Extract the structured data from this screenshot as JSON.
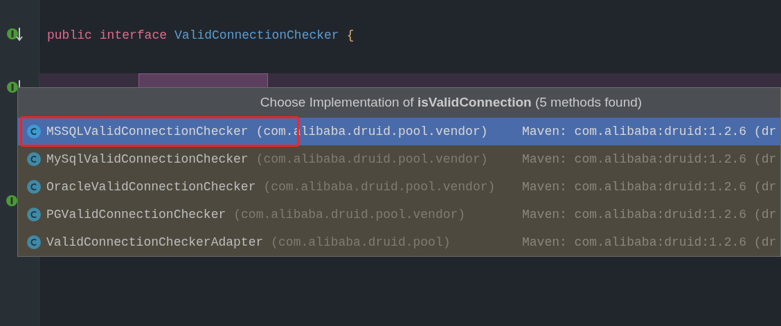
{
  "code_line": [
    {
      "kind": "keyword",
      "text": "public"
    },
    {
      "kind": "keyword",
      "text": "interface"
    },
    {
      "kind": "type",
      "text": "ValidConnectionChecker"
    },
    {
      "kind": "brace",
      "text": "{"
    }
  ],
  "popup": {
    "title_prefix": "Choose Implementation of ",
    "method": "isValidConnection",
    "title_suffix": " (5 methods found)",
    "rows": [
      {
        "name": "MSSQLValidConnectionChecker",
        "package": "(com.alibaba.druid.pool.vendor)",
        "library": "Maven: com.alibaba:druid:1.2.6 (dr",
        "selected": true,
        "highlighted": true
      },
      {
        "name": "MySqlValidConnectionChecker",
        "package": "(com.alibaba.druid.pool.vendor)",
        "library": "Maven: com.alibaba:druid:1.2.6 (dr",
        "selected": false,
        "highlighted": false
      },
      {
        "name": "OracleValidConnectionChecker",
        "package": "(com.alibaba.druid.pool.vendor)",
        "library": "Maven: com.alibaba:druid:1.2.6 (dr",
        "selected": false,
        "highlighted": false
      },
      {
        "name": "PGValidConnectionChecker",
        "package": "(com.alibaba.druid.pool.vendor)",
        "library": "Maven: com.alibaba:druid:1.2.6 (dr",
        "selected": false,
        "highlighted": false
      },
      {
        "name": "ValidConnectionCheckerAdapter",
        "package": "(com.alibaba.druid.pool)",
        "library": "Maven: com.alibaba:druid:1.2.6 (dr",
        "selected": false,
        "highlighted": false
      }
    ]
  }
}
